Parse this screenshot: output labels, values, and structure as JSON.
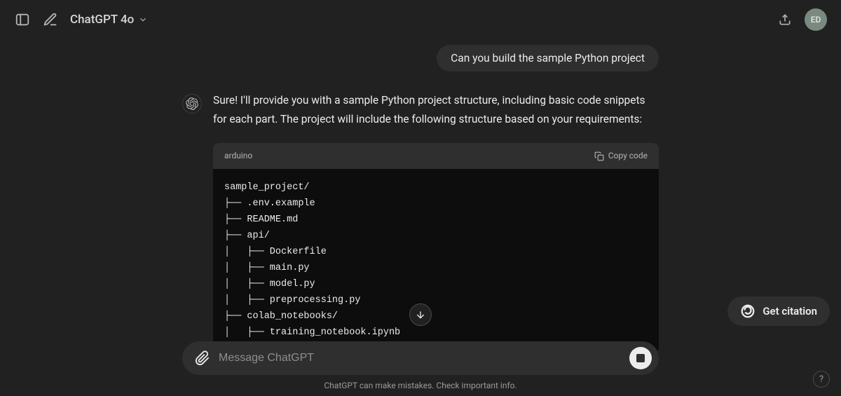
{
  "header": {
    "model_name": "ChatGPT 4o",
    "avatar_initials": "ED"
  },
  "conversation": {
    "user_message": "Can you build the sample Python project",
    "assistant_intro": "Sure! I'll provide you with a sample Python project structure, including basic code snippets for each part. The project will include the following structure based on your requirements:",
    "code_language": "arduino",
    "copy_label": "Copy code",
    "code_content": "sample_project/\n├── .env.example\n├── README.md\n├── api/\n│   ├── Dockerfile\n│   ├── main.py\n│   ├── model.py\n│   ├── preprocessing.py\n├── colab_notebooks/\n│   ├── training_notebook.ipynb"
  },
  "input": {
    "placeholder": "Message ChatGPT"
  },
  "footer": {
    "disclaimer": "ChatGPT can make mistakes. Check important info."
  },
  "citation": {
    "label": "Get citation"
  },
  "help": {
    "label": "?"
  }
}
